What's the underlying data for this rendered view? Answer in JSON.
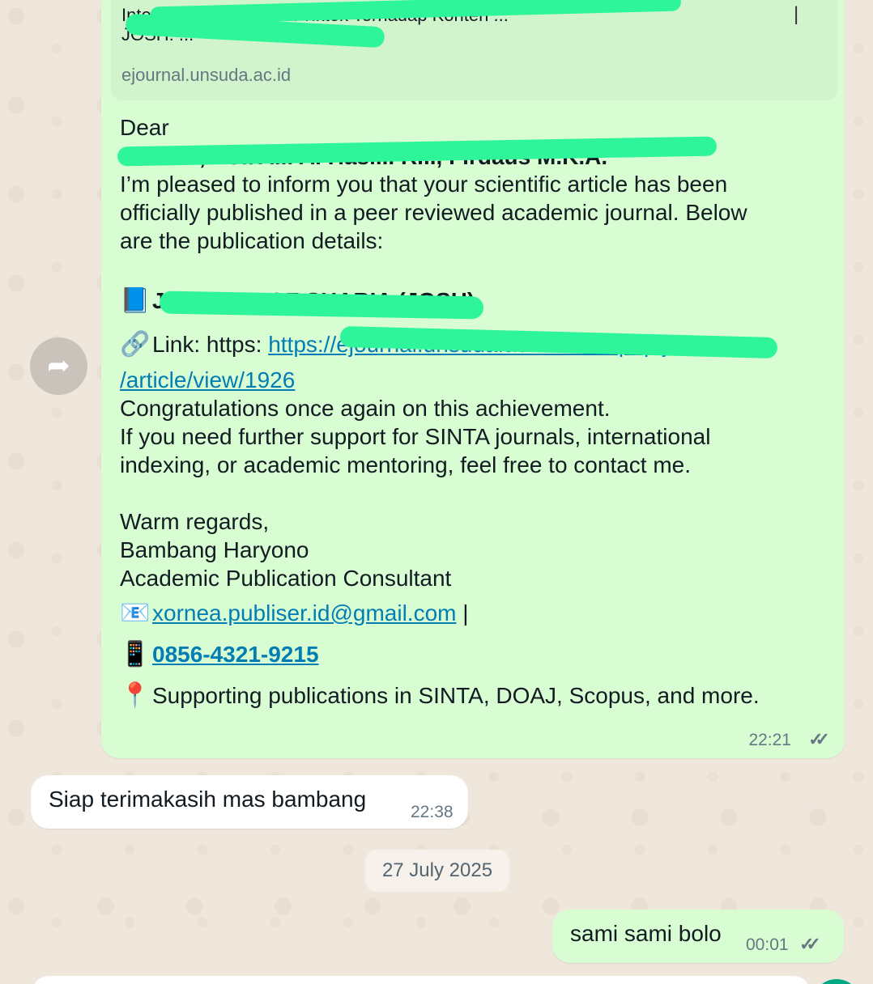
{
  "main_message": {
    "preview": {
      "title_line1": "Interpretasi Pengguna Tiktok Terhadap Konten ...",
      "title_line2": "JOSH: ...",
      "domain": "ejournal.unsuda.ac.id"
    },
    "greeting": "Dear",
    "recipients": "... M.H.I, Asa A... A. Hasi... R..., Firdaus M.K.A.",
    "body_lines": [
      "I’m pleased to inform you that your scientific article has been",
      "officially published in a peer reviewed academic journal. Below",
      "are the publication details:"
    ],
    "journal_icon": "📘",
    "journal_name": "JOURNAL OF SHARIA (JOSH)",
    "link_icon": "🔗",
    "link_label": "Link: https: ",
    "link_url_part1": "https://ejournal.unsuda.ac.id/index.php/josh",
    "link_url_part2": "/article/view/1926",
    "congrats": "Congratulations once again on this achievement.",
    "support_lines": [
      "If you need further support for SINTA journals, international",
      "indexing, or academic mentoring, feel free to contact me."
    ],
    "signoff": "Warm regards,",
    "name": "Bambang Haryono",
    "role": "Academic Publication Consultant",
    "email_icon": "📧",
    "email": "xornea.publiser.id@gmail.com",
    "email_sep": " |",
    "phone_icon": "📱",
    "phone": "0856-4321-9215",
    "pin_icon": "📍",
    "supporting": "Supporting publications in SINTA, DOAJ, Scopus, and more.",
    "time": "22:21",
    "ticks": "✓✓"
  },
  "forward_icon": "forward-icon",
  "incoming_reply": {
    "text": "Siap terimakasih mas bambang",
    "time": "22:38"
  },
  "date_chip": "27 July 2025",
  "outgoing_reply": {
    "text": "sami sami bolo",
    "time": "00:01",
    "ticks": "✓✓"
  },
  "colors": {
    "outgoing_bubble": "#d9fdd3",
    "incoming_bubble": "#ffffff",
    "link": "#027eb5",
    "redaction": "#2ef59a"
  }
}
